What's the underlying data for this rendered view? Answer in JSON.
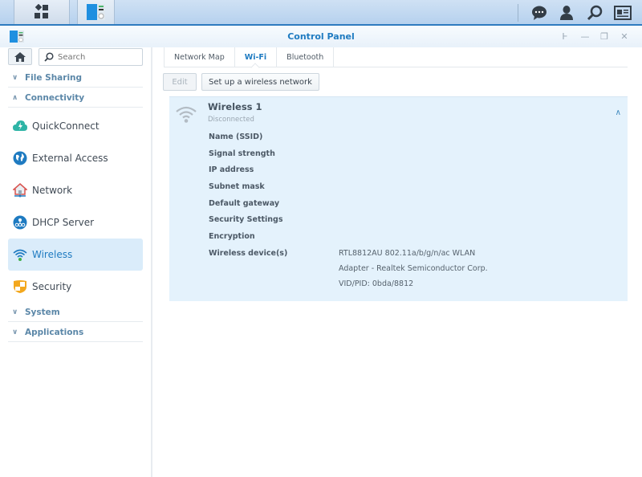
{
  "taskbar": {
    "main_menu_icon": "grid-icon",
    "open_app_icon": "control-panel-icon",
    "right_icons": [
      "chat-icon",
      "user-icon",
      "search-icon",
      "widgets-icon"
    ]
  },
  "window": {
    "title": "Control Panel",
    "controls": [
      "pin-icon",
      "minimize-icon",
      "restore-icon",
      "close-icon"
    ]
  },
  "sidebar": {
    "home_icon": "home-icon",
    "search_placeholder": "Search",
    "groups": {
      "file_sharing": {
        "label": "File Sharing",
        "expanded": false
      },
      "connectivity": {
        "label": "Connectivity",
        "expanded": true
      },
      "system": {
        "label": "System",
        "expanded": false
      },
      "applications": {
        "label": "Applications",
        "expanded": false
      }
    },
    "items": [
      {
        "label": "QuickConnect",
        "icon": "quickconnect-icon"
      },
      {
        "label": "External Access",
        "icon": "globe-icon"
      },
      {
        "label": "Network",
        "icon": "network-house-icon"
      },
      {
        "label": "DHCP Server",
        "icon": "dhcp-icon"
      },
      {
        "label": "Wireless",
        "icon": "wifi-icon",
        "active": true
      },
      {
        "label": "Security",
        "icon": "shield-icon"
      }
    ]
  },
  "main": {
    "tabs": [
      {
        "label": "Network Map"
      },
      {
        "label": "Wi-Fi",
        "active": true
      },
      {
        "label": "Bluetooth"
      }
    ],
    "toolbar": {
      "edit_label": "Edit",
      "setup_label": "Set up a wireless network"
    },
    "interface": {
      "name": "Wireless 1",
      "status": "Disconnected",
      "fields": [
        {
          "label": "Name (SSID)",
          "value": ""
        },
        {
          "label": "Signal strength",
          "value": ""
        },
        {
          "label": "IP address",
          "value": ""
        },
        {
          "label": "Subnet mask",
          "value": ""
        },
        {
          "label": "Default gateway",
          "value": ""
        },
        {
          "label": "Security Settings",
          "value": ""
        },
        {
          "label": "Encryption",
          "value": ""
        },
        {
          "label": "Wireless device(s)",
          "value_lines": [
            "RTL8812AU 802.11a/b/g/n/ac WLAN",
            "Adapter - Realtek Semiconductor Corp.",
            "VID/PID: 0bda/8812"
          ]
        }
      ]
    }
  }
}
